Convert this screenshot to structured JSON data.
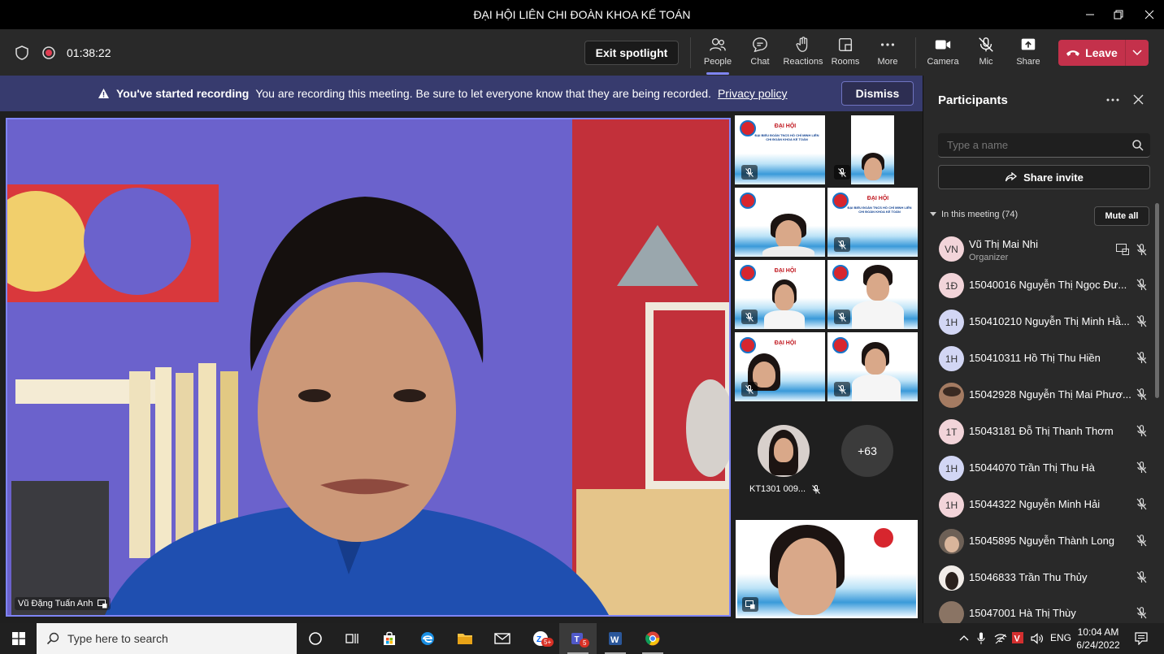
{
  "window": {
    "title": "ĐẠI HỘI LIÊN CHI ĐOÀN KHOA KẾ TOÁN"
  },
  "toolbar": {
    "timer": "01:38:22",
    "exit_spotlight": "Exit spotlight",
    "buttons": {
      "people": "People",
      "chat": "Chat",
      "reactions": "Reactions",
      "rooms": "Rooms",
      "more": "More",
      "camera": "Camera",
      "mic": "Mic",
      "share": "Share"
    },
    "leave": "Leave"
  },
  "banner": {
    "title": "You've started recording",
    "message": "You are recording this meeting. Be sure to let everyone know that they are being recorded.",
    "link": "Privacy policy",
    "dismiss": "Dismiss"
  },
  "stage": {
    "spotlight_name": "Vũ Đặng Tuấn Anh",
    "slide_heading": "ĐẠI HỘI",
    "slide_sub": "ĐẠI BIỂU ĐOÀN TNCS HỒ CHÍ MINH LIÊN CHI ĐOÀN KHOA KẾ TOÁN",
    "small_participant": "KT1301 009...",
    "overflow_count": "+63"
  },
  "panel": {
    "title": "Participants",
    "search_placeholder": "Type a name",
    "share_invite": "Share invite",
    "in_meeting": "In this meeting (74)",
    "mute_all": "Mute all",
    "participants": [
      {
        "initials": "VN",
        "name": "Vũ Thị Mai Nhi",
        "role": "Organizer"
      },
      {
        "initials": "1Đ",
        "name": "15040016 Nguyễn Thị Ngọc Đư..."
      },
      {
        "initials": "1H",
        "name": "150410210 Nguyễn Thị Minh Hằ..."
      },
      {
        "initials": "1H",
        "name": "150410311 Hồ Thị Thu Hiền"
      },
      {
        "initials": "",
        "name": "15042928 Nguyễn Thị Mai Phươ..."
      },
      {
        "initials": "1T",
        "name": "15043181 Đỗ Thị Thanh Thơm"
      },
      {
        "initials": "1H",
        "name": "15044070 Trần Thị Thu Hà"
      },
      {
        "initials": "1H",
        "name": "15044322 Nguyễn Minh Hải"
      },
      {
        "initials": "",
        "name": "15045895 Nguyễn Thành Long"
      },
      {
        "initials": "",
        "name": "15046833 Trần Thu Thủy"
      },
      {
        "initials": "",
        "name": "15047001 Hà Thị Thùy"
      }
    ]
  },
  "taskbar": {
    "search_placeholder": "Type here to search",
    "teams_badge": "5",
    "zalo_badge": "5+",
    "lang": "ENG",
    "time": "10:04 AM",
    "date": "6/24/2022"
  },
  "colors": {
    "accent": "#7f85f5",
    "leave": "#c4314b",
    "banner": "#373b6e"
  }
}
